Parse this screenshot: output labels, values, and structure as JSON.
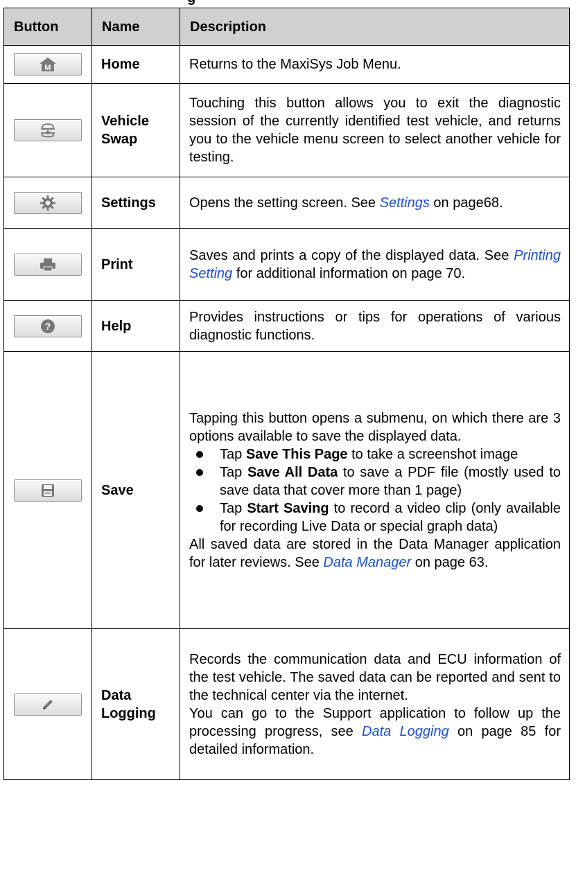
{
  "caption": "g",
  "table": {
    "headers": {
      "button": "Button",
      "name": "Name",
      "description": "Description"
    },
    "rows": {
      "home": {
        "icon": "home-m-icon",
        "name": "Home",
        "desc": "Returns to the MaxiSys Job Menu."
      },
      "vehicle_swap": {
        "icon": "vehicle-swap-icon",
        "name_line1": "Vehicle",
        "name_line2": "Swap",
        "desc": "Touching this button allows you to exit the diagnostic session of the currently identified test vehicle, and returns you to the vehicle menu screen to select another vehicle for testing."
      },
      "settings": {
        "icon": "gear-icon",
        "name": "Settings",
        "desc_pre": "Opens the setting screen. See ",
        "desc_link": "Settings",
        "desc_post": " on page68."
      },
      "print": {
        "icon": "printer-icon",
        "name": "Print",
        "desc_pre": "Saves and prints a copy of the displayed data. See ",
        "desc_link": "Printing Setting",
        "desc_post": " for additional information on page 70."
      },
      "help": {
        "icon": "question-icon",
        "name": "Help",
        "desc": "Provides instructions or tips for operations of various diagnostic functions."
      },
      "save": {
        "icon": "floppy-disk-icon",
        "name": "Save",
        "intro": "Tapping this button opens a submenu, on which there are 3 options available to save the displayed data.",
        "options": [
          {
            "pre": "Tap ",
            "bold": "Save This Page",
            "post": " to take a screenshot image"
          },
          {
            "pre": "Tap ",
            "bold": "Save All Data",
            "post": " to save a PDF file (mostly used to save data that cover more than 1 page)"
          },
          {
            "pre": "Tap ",
            "bold": "Start Saving",
            "post": " to record a video clip (only available for recording Live Data or special graph data)"
          }
        ],
        "outro_pre": "All saved data are stored in the Data Manager application for later reviews. See ",
        "outro_link": "Data Manager",
        "outro_post": " on page 63."
      },
      "data_logging": {
        "icon": "pencil-icon",
        "name_line1": "Data",
        "name_line2": "Logging",
        "desc1": "Records the communication data and ECU information of the test vehicle. The saved data can be reported and sent to the technical center via the internet.",
        "desc2_pre": "You can go to the Support application to follow up the processing progress, see ",
        "desc2_link": "Data Logging",
        "desc2_post": " on page 85 for detailed information."
      }
    }
  }
}
